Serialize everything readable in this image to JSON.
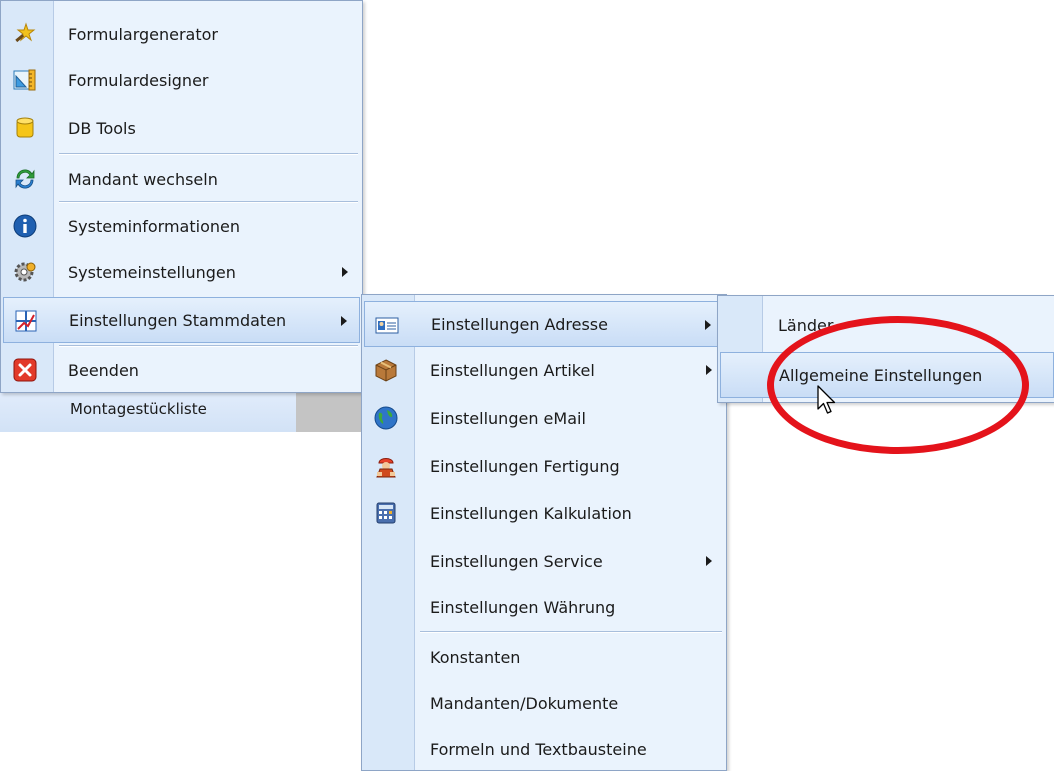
{
  "menu_main": {
    "items": [
      {
        "label": "Formulargenerator",
        "icon": "wand-icon"
      },
      {
        "label": "Formulardesigner",
        "icon": "ruler-icon"
      },
      {
        "label": "DB Tools",
        "icon": "database-icon"
      },
      {
        "label": "Mandant wechseln",
        "icon": "refresh-icon"
      },
      {
        "label": "Systeminformationen",
        "icon": "info-icon"
      },
      {
        "label": "Systemeinstellungen",
        "icon": "gear-icon",
        "submenu": true
      },
      {
        "label": "Einstellungen Stammdaten",
        "icon": "grid-settings-icon",
        "submenu": true,
        "highlighted": true
      },
      {
        "label": "Beenden",
        "icon": "close-icon"
      }
    ]
  },
  "background_item": {
    "label": "Montagestückliste"
  },
  "menu_stammdaten": {
    "items": [
      {
        "label": "Einstellungen Adresse",
        "icon": "address-card-icon",
        "submenu": true,
        "highlighted": true
      },
      {
        "label": "Einstellungen Artikel",
        "icon": "box-icon",
        "submenu": true
      },
      {
        "label": "Einstellungen eMail",
        "icon": "globe-icon"
      },
      {
        "label": "Einstellungen Fertigung",
        "icon": "worker-icon"
      },
      {
        "label": "Einstellungen Kalkulation",
        "icon": "calculator-icon"
      },
      {
        "label": "Einstellungen Service",
        "submenu": true
      },
      {
        "label": "Einstellungen Währung"
      },
      {
        "label": "Konstanten"
      },
      {
        "label": "Mandanten/Dokumente"
      },
      {
        "label": "Formeln und Textbausteine"
      }
    ]
  },
  "menu_adresse": {
    "items": [
      {
        "label": "Länder"
      },
      {
        "label": "Allgemeine Einstellungen",
        "highlighted": true
      }
    ]
  },
  "colors": {
    "menu_bg": "#eaf3fd",
    "highlight_border": "#8eb1de",
    "annotation_ring": "#e4131b"
  }
}
